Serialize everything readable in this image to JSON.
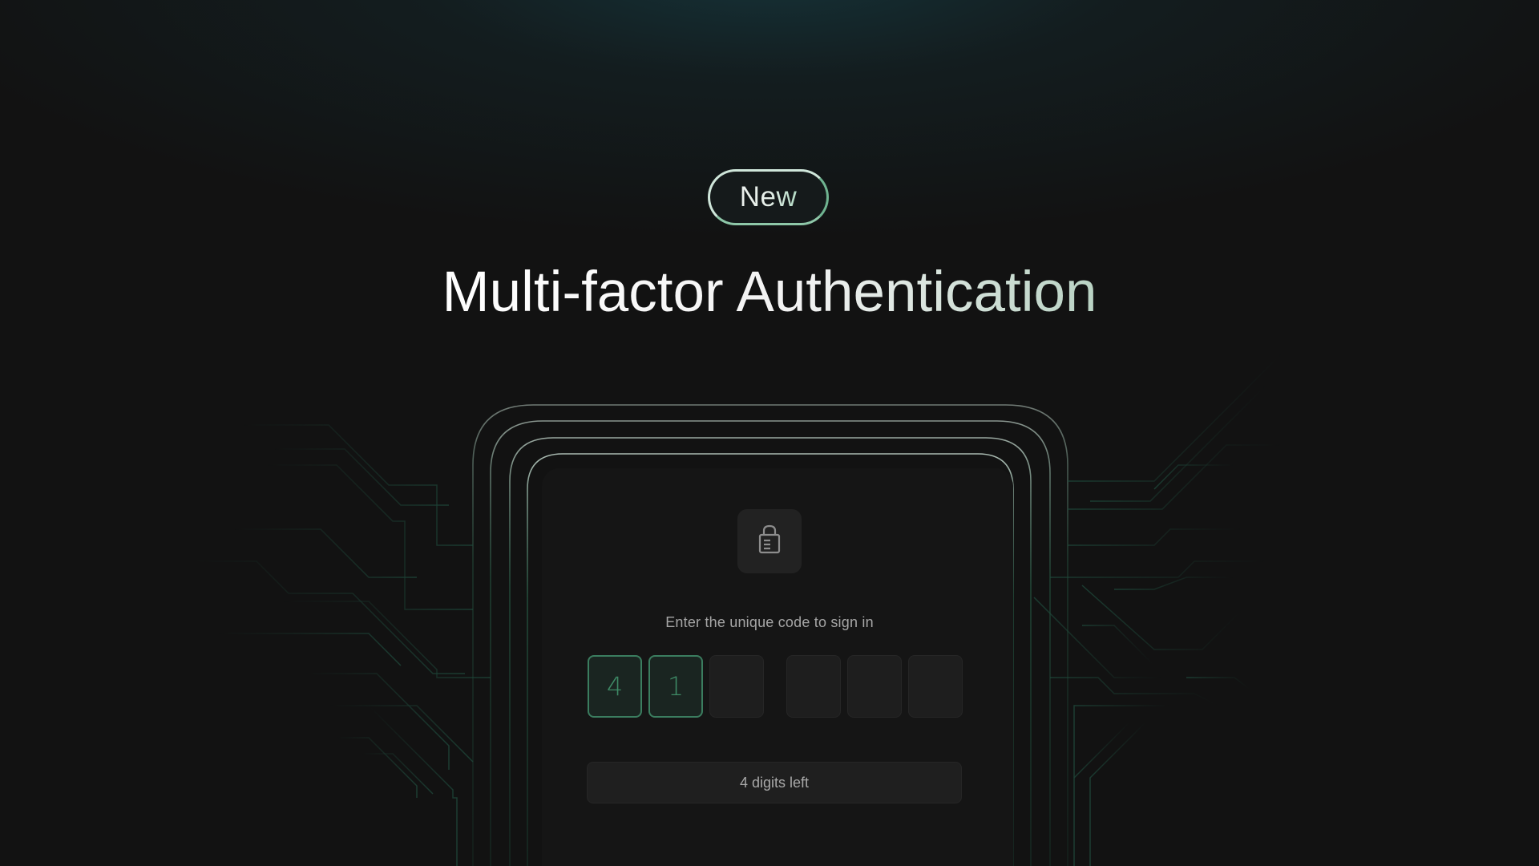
{
  "badge": {
    "label": "New"
  },
  "heading": {
    "title": "Multi-factor Authentication"
  },
  "auth_card": {
    "icon": "lock-icon",
    "prompt": "Enter the unique code to sign in",
    "code_digits": [
      "4",
      "1",
      "",
      "",
      "",
      ""
    ],
    "status": "4 digits left"
  },
  "colors": {
    "background": "#121212",
    "accent_green": "#3b7d5f",
    "circuit_line": "#1f4a3c",
    "text_primary": "#f2f2f2",
    "text_muted": "#a6a6a6"
  }
}
